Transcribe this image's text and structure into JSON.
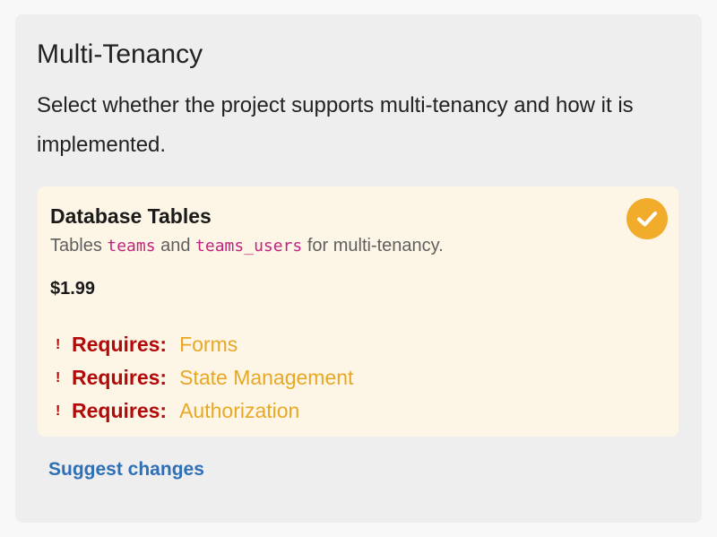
{
  "section": {
    "title": "Multi-Tenancy",
    "description": "Select whether the project supports multi-tenancy and how it is implemented."
  },
  "option": {
    "title": "Database Tables",
    "selected": true,
    "desc_prefix": "Tables ",
    "code_1": "teams",
    "desc_and": " and ",
    "code_2": "teams_users",
    "desc_suffix": " for multi-tenancy.",
    "price": "$1.99",
    "requirements": [
      {
        "bang": "!",
        "label": "Requires:",
        "item": "Forms"
      },
      {
        "bang": "!",
        "label": "Requires:",
        "item": "State Management"
      },
      {
        "bang": "!",
        "label": "Requires:",
        "item": "Authorization"
      }
    ]
  },
  "footer": {
    "suggest_label": "Suggest changes"
  },
  "colors": {
    "accent": "#f1ac2c",
    "requires": "#b20a0a",
    "link": "#2f6fb6",
    "code": "#c2227f",
    "card_bg": "#fdf6e6"
  },
  "icons": {
    "selected": "check-circle-icon",
    "warning": "exclamation-icon"
  }
}
